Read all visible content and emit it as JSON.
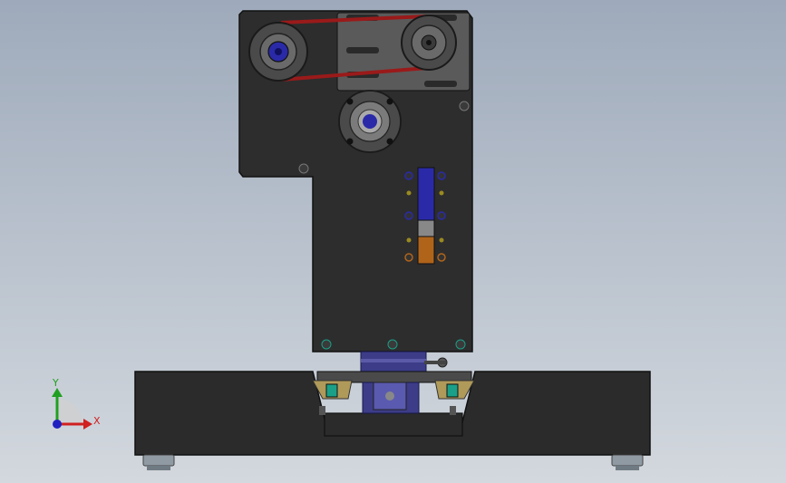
{
  "viewport": {
    "background_top": "#9eaabb",
    "background_bottom": "#d3d8de"
  },
  "model": {
    "body_color": "#2d2d2d",
    "body_edge_color": "#111111",
    "belt_color": "#9a1a1a",
    "blue_part_color": "#2a2aa8",
    "orange_part_color": "#b0641a",
    "base_color": "#2b2b2b",
    "foot_color": "#8f9aa3"
  },
  "triad": {
    "x_label": "X",
    "y_label": "Y",
    "x_color": "#d02020",
    "y_color": "#20a020",
    "z_color": "#2020c0"
  }
}
